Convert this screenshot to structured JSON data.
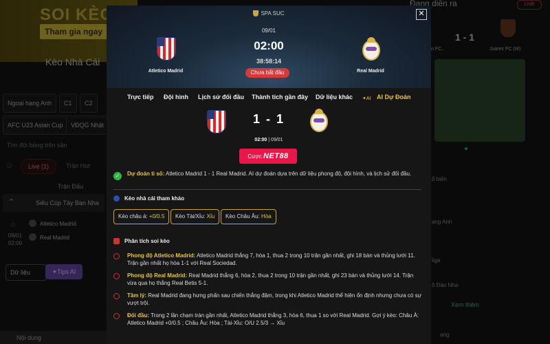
{
  "background": {
    "banner_title": "SOI KÈO C",
    "banner_button": "Tham gia ngay",
    "section_title": "Kèo Nhà Cái",
    "league_chips": [
      "Ngoại hạng Anh",
      "C1",
      "C2"
    ],
    "league_chips_row2": [
      "AFC U23 Asian Cup",
      "VĐQG Nhật"
    ],
    "search_placeholder": "Tìm đội bóng trên sân",
    "live_label": "Live (1)",
    "after_live": "Trận Hot",
    "col_match": "Trận Đấu",
    "league_row": "Siêu Cúp Tây Ban Nha",
    "match_date": "09/01",
    "match_time": "02:00",
    "match_home": "Atletico Madrid",
    "match_away": "Real Madrid",
    "btn_data": "Dữ liệu",
    "btn_tips": "Tips AI",
    "bottom_label": "Nội dung",
    "right_title": "Đang diễn ra",
    "right_live": "LIVE",
    "right_score": "1 - 1",
    "right_team1": "n FC..",
    "right_team2": "Juarez FC (W)",
    "right_items": [
      "ổ biến",
      "ạng Anh",
      "liga",
      "ồ Đào Nha"
    ],
    "right_more": "Xem thêm",
    "right_bottom": "ạng"
  },
  "modal": {
    "league": "SPA SUC",
    "date": "09/01",
    "time": "02:00",
    "countdown": "38:58:14",
    "status": "Chưa bắt đầu",
    "home_team": "Atletico Madrid",
    "away_team": "Real Madrid",
    "tabs": [
      "Trực tiếp",
      "Đội hình",
      "Lịch sử đối đầu",
      "Thành tích gần đây",
      "Dữ liệu khác",
      "AI Dự Đoán"
    ],
    "ai_badge": "AI",
    "score": "1 - 1",
    "score_time": "02:00",
    "score_date": "09/01",
    "bet_prefix": "Cược",
    "bet_brand": "NET88",
    "prediction_label": "Dự đoán tỉ số:",
    "prediction_text": "Atletico Madrid 1 - 1 Real Madrid. AI dự đoán dựa trên dữ liệu phong độ, đội hình, và lịch sử đối đầu.",
    "odds_title": "Kèo nhà cái tham khảo",
    "odds": [
      {
        "label": "Kèo châu á:",
        "value": "+0/0.5"
      },
      {
        "label": "Kèo Tài/Xỉu:",
        "value": "Xỉu"
      },
      {
        "label": "Kèo Châu Âu:",
        "value": "Hòa"
      }
    ],
    "analysis_title": "Phân tích soi kèo",
    "analysis": [
      {
        "label": "Phong độ Atletico Madrid:",
        "text": "Atletico Madrid thắng 7, hòa 1, thua 2 trong 10 trận gần nhất, ghi 18 bàn và thủng lưới 11. Trận gần nhất họ hòa 1-1 với Real Sociedad."
      },
      {
        "label": "Phong độ Real Madrid:",
        "text": "Real Madrid thắng 6, hòa 2, thua 2 trong 10 trận gần nhất, ghi 23 bàn và thủng lưới 14. Trận vừa qua họ thắng Real Betis 5-1."
      },
      {
        "label": "Tâm lý:",
        "text": "Real Madrid đang hưng phấn sau chiến thắng đậm, trong khi Atletico Madrid thể hiện ổn định nhưng chưa có sự vượt trội."
      },
      {
        "label": "Đối đầu:",
        "text": "Trong 2 lần chạm trán gần nhất, Atletico Madrid thắng 3, hòa 6, thua 1 so với Real Madrid. Gợi ý kèo: Châu Á: Atletico Madrid +0/0.5 ; Châu Âu: Hòa ; Tài-Xỉu: O/U 2.5/3 → Xỉu"
      }
    ]
  }
}
